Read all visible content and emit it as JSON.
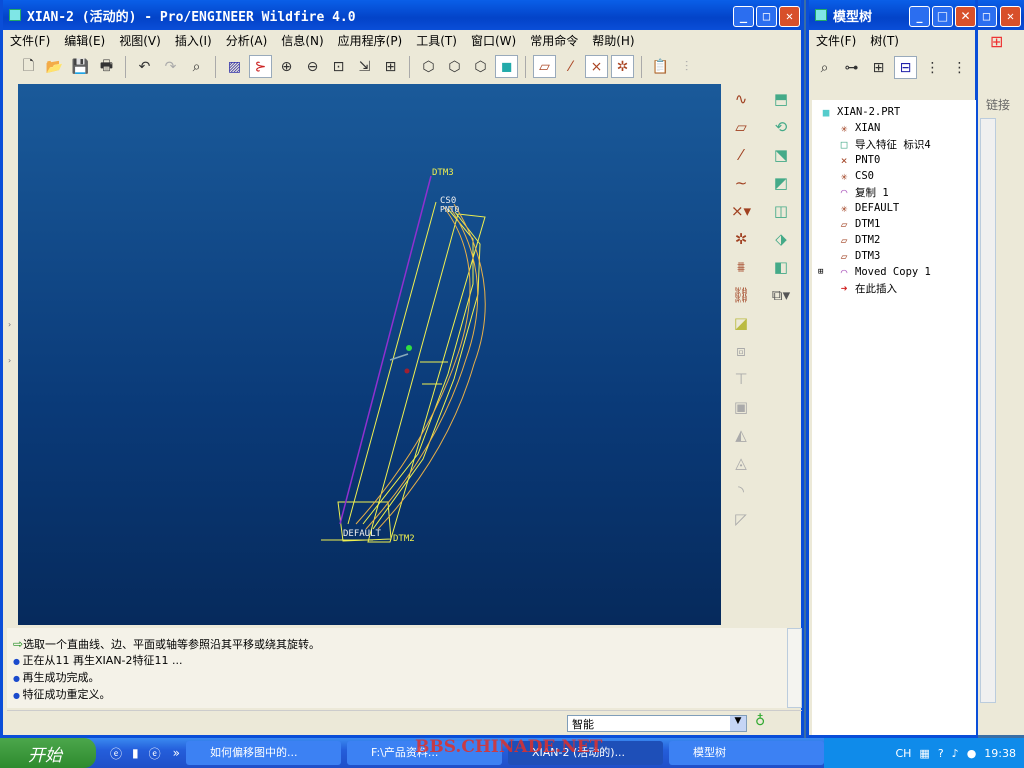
{
  "main_window": {
    "title": "XIAN-2 (活动的) - Pro/ENGINEER Wildfire 4.0",
    "menu": [
      "文件(F)",
      "编辑(E)",
      "视图(V)",
      "插入(I)",
      "分析(A)",
      "信息(N)",
      "应用程序(P)",
      "工具(T)",
      "窗口(W)",
      "常用命令",
      "帮助(H)"
    ],
    "viewport_labels": {
      "dtm3": "DTM3",
      "cs0": "CS0",
      "pnt0": "PNT0",
      "default": "DEFAULT",
      "dtm2": "DTM2"
    },
    "messages": [
      "选取一个直曲线、边、平面或轴等参照沿其平移或绕其旋转。",
      "正在从11 再生XIAN-2特征11 ...",
      "再生成功完成。",
      "特征成功重定义。"
    ],
    "filter": "智能"
  },
  "model_tree": {
    "title": "模型树",
    "menu": [
      "文件(F)",
      "树(T)"
    ],
    "items": [
      {
        "label": "XIAN-2.PRT",
        "icon": "part-icon"
      },
      {
        "label": "XIAN",
        "icon": "axis-icon"
      },
      {
        "label": "导入特征 标识4",
        "icon": "import-icon"
      },
      {
        "label": "PNT0",
        "icon": "point-icon"
      },
      {
        "label": "CS0",
        "icon": "csys-icon"
      },
      {
        "label": "复制 1",
        "icon": "copy-icon"
      },
      {
        "label": "DEFAULT",
        "icon": "csys-icon"
      },
      {
        "label": "DTM1",
        "icon": "plane-icon"
      },
      {
        "label": "DTM2",
        "icon": "plane-icon"
      },
      {
        "label": "DTM3",
        "icon": "plane-icon"
      },
      {
        "label": "Moved Copy 1",
        "icon": "copy-icon"
      },
      {
        "label": "在此插入",
        "icon": "insert-arrow-icon"
      }
    ]
  },
  "back_window": {
    "tab": "链接"
  },
  "taskbar": {
    "start": "开始",
    "tasks": [
      "如何偏移图中的...",
      "F:\\产品资料...",
      "XIAN-2 (活动的)...",
      "模型树"
    ],
    "lang": "CH",
    "time": "19:38"
  },
  "watermark": "BBS.CHINADE.NET"
}
